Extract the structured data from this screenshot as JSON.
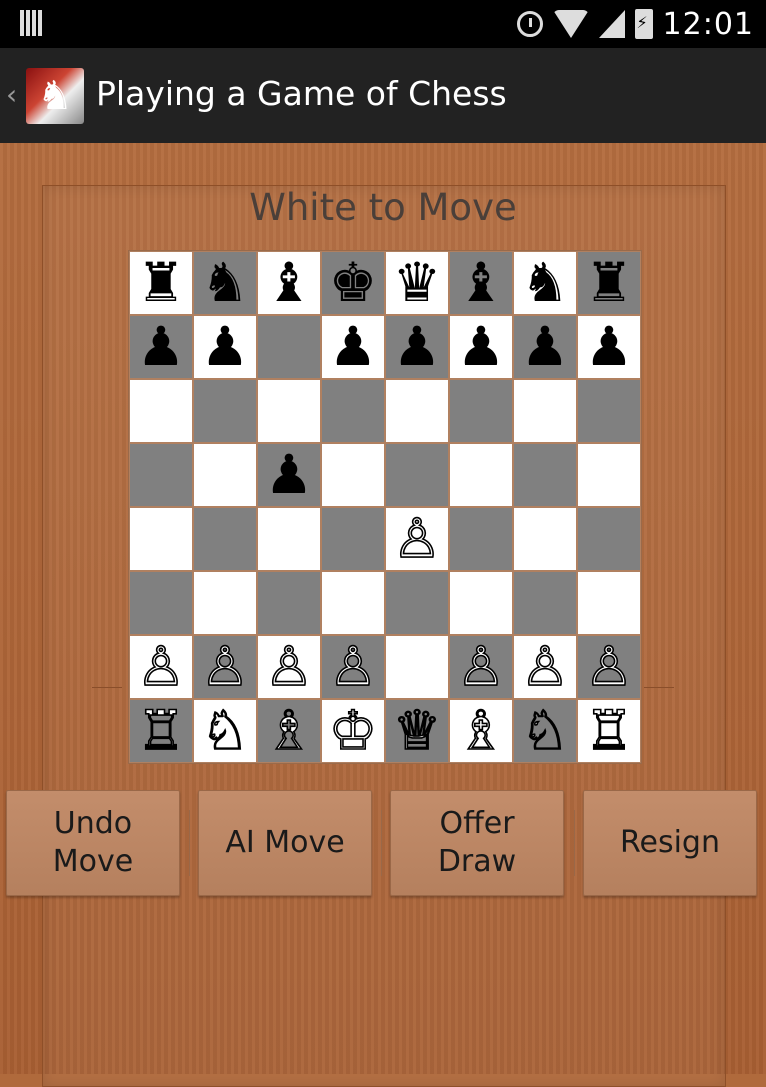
{
  "status_bar": {
    "time": "12:01",
    "icons": [
      "notifications-icon",
      "alarm-icon",
      "wifi-icon",
      "signal-icon",
      "battery-charging-icon"
    ]
  },
  "action_bar": {
    "title": "Playing a Game of Chess",
    "logo_icon": "chess-knight-logo-icon",
    "back_icon": "chevron-left-icon"
  },
  "game": {
    "turn_text": "White to Move",
    "board": {
      "colors": {
        "light": "#ffffff",
        "dark": "#808080"
      },
      "ranks": [
        [
          "♜",
          "♞",
          "♝",
          "♚",
          "♛",
          "♝",
          "♞",
          "♜"
        ],
        [
          "♟",
          "♟",
          "",
          "♟",
          "♟",
          "♟",
          "♟",
          "♟"
        ],
        [
          "",
          "",
          "",
          "",
          "",
          "",
          "",
          ""
        ],
        [
          "",
          "",
          "♟",
          "",
          "",
          "",
          "",
          ""
        ],
        [
          "",
          "",
          "",
          "",
          "♙",
          "",
          "",
          ""
        ],
        [
          "",
          "",
          "",
          "",
          "",
          "",
          "",
          ""
        ],
        [
          "♙",
          "♙",
          "♙",
          "♙",
          "",
          "♙",
          "♙",
          "♙"
        ],
        [
          "♖",
          "♘",
          "♗",
          "♔",
          "♕",
          "♗",
          "♘",
          "♖"
        ]
      ]
    }
  },
  "buttons": {
    "undo": "Undo\nMove",
    "ai_move": "AI Move",
    "offer_draw": "Offer\nDraw",
    "resign": "Resign"
  }
}
